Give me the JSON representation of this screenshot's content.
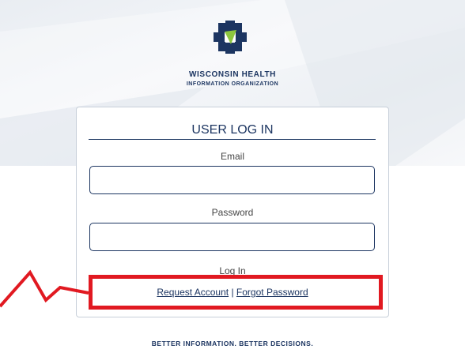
{
  "org": {
    "name": "WISCONSIN HEALTH",
    "subtitle": "INFORMATION ORGANIZATION",
    "logo_icon": "cross-puzzle-logo-icon"
  },
  "login": {
    "title": "USER LOG IN",
    "email_label": "Email",
    "email_value": "",
    "password_label": "Password",
    "password_value": "",
    "login_button": "Log In",
    "request_account": "Request Account",
    "separator": "|",
    "forgot_password": "Forgot Password"
  },
  "annotation": {
    "color": "#e11921",
    "type": "red-callout-box-with-arrow"
  },
  "footer": {
    "tagline": "BETTER INFORMATION. BETTER DECISIONS."
  },
  "colors": {
    "brand_navy": "#1c3561",
    "brand_green": "#8cc63f"
  }
}
